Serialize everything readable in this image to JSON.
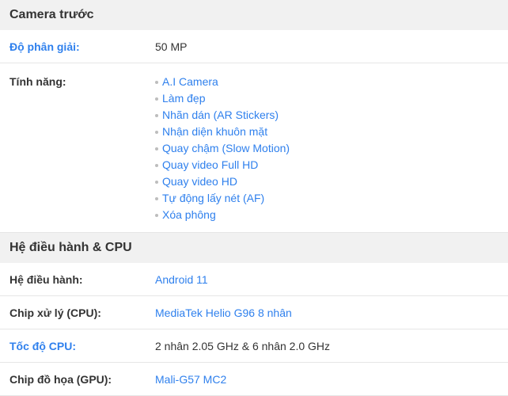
{
  "front_camera": {
    "title": "Camera trước",
    "resolution": {
      "label": "Độ phân giải:",
      "value": "50 MP"
    },
    "features": {
      "label": "Tính năng:",
      "items": [
        "A.I Camera",
        "Làm đẹp",
        "Nhãn dán (AR Stickers)",
        "Nhận diện khuôn mặt",
        "Quay chậm (Slow Motion)",
        "Quay video Full HD",
        "Quay video HD",
        "Tự động lấy nét (AF)",
        "Xóa phông"
      ]
    }
  },
  "os_cpu": {
    "title": "Hệ điều hành & CPU",
    "os": {
      "label": "Hệ điều hành:",
      "value": "Android 11"
    },
    "cpu": {
      "label": "Chip xử lý (CPU):",
      "value": "MediaTek Helio G96 8 nhân"
    },
    "cpu_speed": {
      "label": "Tốc độ CPU:",
      "value": "2 nhân 2.05 GHz & 6 nhân 2.0 GHz"
    },
    "gpu": {
      "label": "Chip đồ họa (GPU):",
      "value": "Mali-G57 MC2"
    }
  },
  "colors": {
    "link": "#2f80ed",
    "text": "#333333",
    "header_bg": "#f1f1f1",
    "divider": "#e6e6e6"
  }
}
